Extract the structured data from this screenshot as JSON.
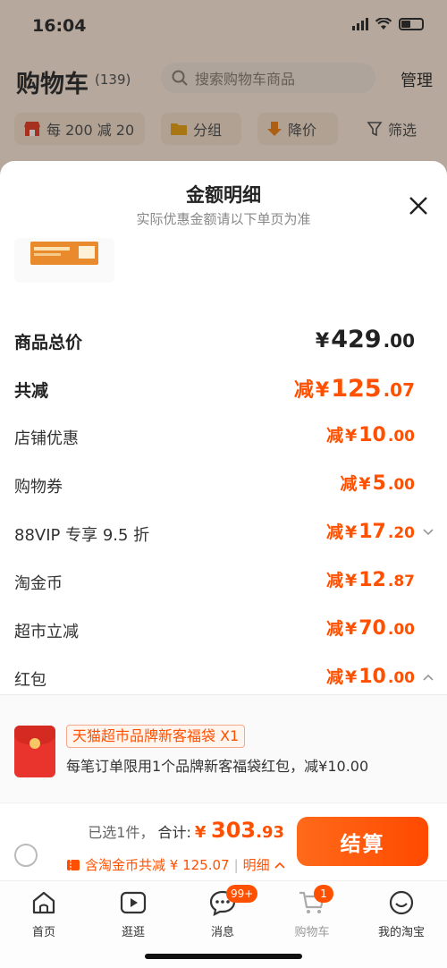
{
  "status_bar": {
    "time": "16:04"
  },
  "cart_header": {
    "title": "购物车",
    "count": "(139)",
    "search_placeholder": "搜索购物车商品",
    "manage_label": "管理"
  },
  "filter_chips": [
    {
      "label": "每 200 减 20",
      "icon": "shop-icon"
    },
    {
      "label": "分组",
      "icon": "folder-icon"
    },
    {
      "label": "降价",
      "icon": "price-down-icon"
    },
    {
      "label": "筛选",
      "icon": "filter-icon"
    }
  ],
  "sheet": {
    "title": "金额明细",
    "subtitle": "实际优惠金额请以下单页为准",
    "rows": [
      {
        "label": "商品总价",
        "prefix": "",
        "yen": "¥",
        "int": "429",
        "dec": ".00"
      },
      {
        "label": "共减",
        "prefix": "减",
        "yen": "¥",
        "int": "125",
        "dec": ".07"
      },
      {
        "label": "店铺优惠",
        "prefix": "减",
        "yen": "¥",
        "int": "10",
        "dec": ".00"
      },
      {
        "label": "购物券",
        "prefix": "减",
        "yen": "¥",
        "int": "5",
        "dec": ".00"
      },
      {
        "label": "88VIP 专享 9.5 折",
        "prefix": "减",
        "yen": "¥",
        "int": "17",
        "dec": ".20"
      },
      {
        "label": "淘金币",
        "prefix": "减",
        "yen": "¥",
        "int": "12",
        "dec": ".87"
      },
      {
        "label": "超市立减",
        "prefix": "减",
        "yen": "¥",
        "int": "70",
        "dec": ".00"
      },
      {
        "label": "红包",
        "prefix": "减",
        "yen": "¥",
        "int": "10",
        "dec": ".00"
      }
    ],
    "red_packet": {
      "tag": "天猫超市品牌新客福袋 X1",
      "desc": "每笔订单限用1个品牌新客福袋红包，减¥10.00"
    }
  },
  "checkout": {
    "selected": "已选1件，",
    "sum_label": "合计:",
    "sum_yen": "¥",
    "sum_int": "303",
    "sum_dec": ".93",
    "savings": "含淘金币共减 ¥ 125.07",
    "separator": "|",
    "detail": "明细",
    "pay_label": "结算"
  },
  "tabbar": [
    {
      "label": "首页",
      "icon": "home-icon"
    },
    {
      "label": "逛逛",
      "icon": "video-icon"
    },
    {
      "label": "消息",
      "icon": "message-icon",
      "badge": "99+"
    },
    {
      "label": "购物车",
      "icon": "cart-icon",
      "badge": "1"
    },
    {
      "label": "我的淘宝",
      "icon": "profile-icon"
    }
  ],
  "colors": {
    "accent": "#ff5000",
    "background_dim": "#fde9d8"
  }
}
